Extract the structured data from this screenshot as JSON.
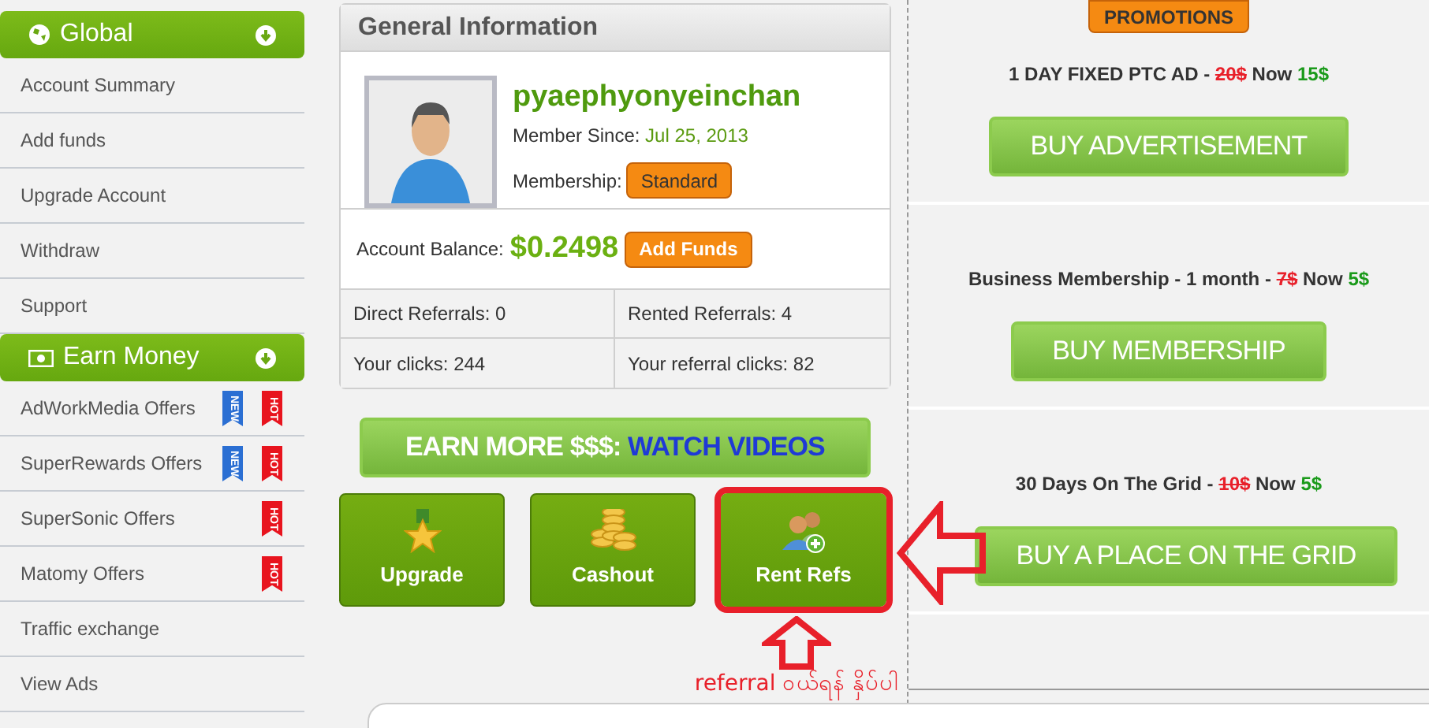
{
  "sidebar": {
    "sections": [
      {
        "title": "Global",
        "kind": "globe",
        "items": [
          {
            "label": "Account Summary"
          },
          {
            "label": "Add funds"
          },
          {
            "label": "Upgrade Account"
          },
          {
            "label": "Withdraw"
          },
          {
            "label": "Support"
          }
        ]
      },
      {
        "title": "Earn Money",
        "kind": "money",
        "items": [
          {
            "label": "AdWorkMedia Offers",
            "badges": [
              {
                "kind": "new",
                "label": "NEW"
              },
              {
                "kind": "hot",
                "label": "HOT"
              }
            ]
          },
          {
            "label": "SuperRewards Offers",
            "badges": [
              {
                "kind": "new",
                "label": "NEW"
              },
              {
                "kind": "hot",
                "label": "HOT"
              }
            ]
          },
          {
            "label": "SuperSonic Offers",
            "badges": [
              {
                "kind": "hot",
                "label": "HOT"
              }
            ]
          },
          {
            "label": "Matomy Offers",
            "badges": [
              {
                "kind": "hot",
                "label": "HOT"
              }
            ]
          },
          {
            "label": "Traffic exchange"
          },
          {
            "label": "View Ads"
          }
        ]
      }
    ]
  },
  "general_info": {
    "title": "General Information",
    "username": "pyaephyonyeinchan",
    "member_since_label": "Member Since:",
    "member_since": "Jul 25, 2013",
    "membership_label": "Membership:",
    "membership": "Standard",
    "balance_label": "Account Balance:",
    "balance": "$0.2498",
    "add_funds": "Add Funds",
    "stats": [
      "Direct Referrals: 0",
      "Rented Referrals: 4",
      "Your clicks: 244",
      "Your referral clicks: 82"
    ]
  },
  "earn_more": {
    "lead": "EARN MORE $$$:",
    "action": "WATCH VIDEOS"
  },
  "tiles": [
    {
      "label": "Upgrade",
      "kind": "star",
      "highlighted": false
    },
    {
      "label": "Cashout",
      "kind": "coins",
      "highlighted": false
    },
    {
      "label": "Rent Refs",
      "kind": "users",
      "highlighted": true
    }
  ],
  "annotation": "referral ဝယ်ရန် နှိပ်ပါ",
  "promotions": {
    "title": "PROMOTIONS",
    "offers": [
      {
        "name": "1 DAY FIXED PTC AD -",
        "old_price": "20$",
        "now": "Now",
        "new_price": "15$",
        "button": "BUY ADVERTISEMENT"
      },
      {
        "name": "Business Membership - 1 month -",
        "old_price": "7$",
        "now": "Now",
        "new_price": "5$",
        "button": "BUY MEMBERSHIP"
      },
      {
        "name": "30 Days On The Grid -",
        "old_price": "10$",
        "now": "Now",
        "new_price": "5$",
        "button": "BUY A PLACE ON THE GRID"
      }
    ]
  }
}
